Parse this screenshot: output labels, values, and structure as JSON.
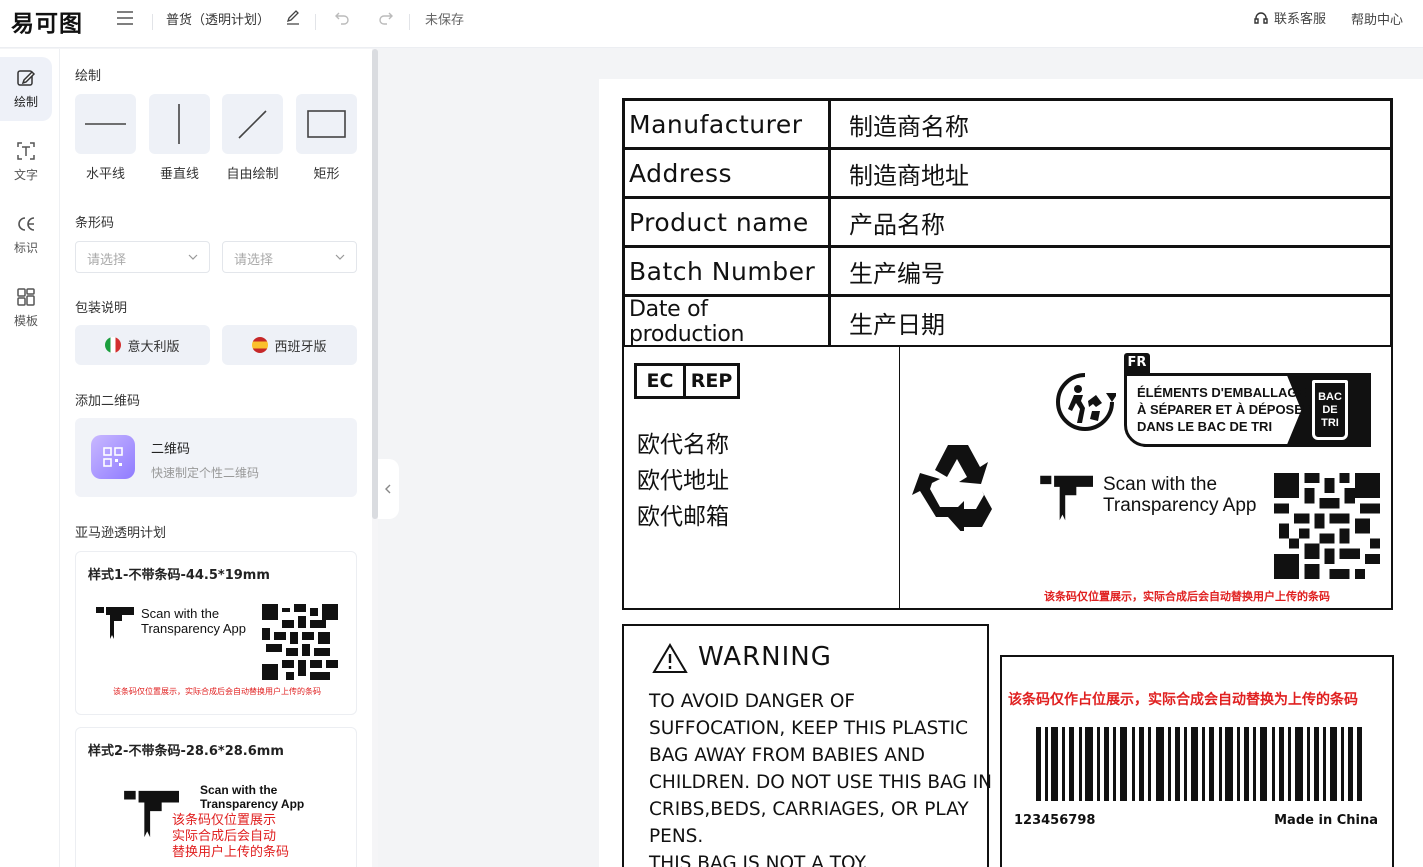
{
  "header": {
    "logo": "易可图",
    "doc_title": "普货（透明计划）",
    "save_status": "未保存",
    "support": "联系客服",
    "help": "帮助中心"
  },
  "rail": [
    {
      "label": "绘制",
      "icon": "draw-icon"
    },
    {
      "label": "文字",
      "icon": "text-icon"
    },
    {
      "label": "标识",
      "icon": "ce-mark-icon"
    },
    {
      "label": "模板",
      "icon": "template-icon"
    }
  ],
  "panel": {
    "draw_title": "绘制",
    "tools": [
      "水平线",
      "垂直线",
      "自由绘制",
      "矩形"
    ],
    "barcode_title": "条形码",
    "select_placeholder_1": "请选择",
    "select_placeholder_2": "请选择",
    "pack_title": "包装说明",
    "pack_italy": "意大利版",
    "pack_spain": "西班牙版",
    "qr_title": "添加二维码",
    "qr_name": "二维码",
    "qr_desc": "快速制定个性二维码",
    "amazon_title": "亚马逊透明计划",
    "style1": "样式1-不带条码-44.5*19mm",
    "style2": "样式2-不带条码-28.6*28.6mm",
    "scan_line1": "Scan with the",
    "scan_line2": "Transparency App",
    "placeholder_note": "该条码仅位置展示，实际合成后会自动替换用户上传的条码",
    "style2_note_1": "该条码仅位置展示",
    "style2_note_2": "实际合成后会自动",
    "style2_note_3": "替换用户上传的条码"
  },
  "label": {
    "rows": [
      {
        "key": "Manufacturer",
        "value": "制造商名称"
      },
      {
        "key": "Address",
        "value": "制造商地址"
      },
      {
        "key": "Product name",
        "value": "产品名称"
      },
      {
        "key": "Batch Number",
        "value": "生产编号"
      },
      {
        "key": "Date of production",
        "value": "生产日期"
      }
    ],
    "ec": "EC",
    "rep": "REP",
    "eu_name": "欧代名称",
    "eu_address": "欧代地址",
    "eu_email": "欧代邮箱",
    "fr_tag": "FR",
    "triman_1": "ÉLÉMENTS D'EMBALLAGE",
    "triman_2": "À SÉPARER ET À DÉPOSER",
    "triman_3": "DANS LE BAC DE TRI",
    "bac_1": "BAC",
    "bac_2": "DE",
    "bac_3": "TRI",
    "scan_1": "Scan with the",
    "scan_2": "Transparency App",
    "qr_note": "该条码仅位置展示，实际合成后会自动替换用户上传的条码",
    "warning_title": "WARNING",
    "warning_lines": [
      "TO AVOID DANGER OF",
      "SUFFOCATION, KEEP THIS PLASTIC",
      "BAG AWAY FROM BABIES AND",
      "CHILDREN. DO NOT USE THIS BAG IN",
      "CRIBS,BEDS, CARRIAGES, OR PLAY",
      "PENS.",
      "THIS BAG IS NOT A TOY."
    ],
    "barcode_note": "该条码仅作占位展示，实际合成会自动替换为上传的条码",
    "barcode_number": "123456798",
    "made_in": "Made in China"
  },
  "colors": {
    "accent": "#7b68ee",
    "note_red": "#e02020",
    "ink": "#111111"
  }
}
